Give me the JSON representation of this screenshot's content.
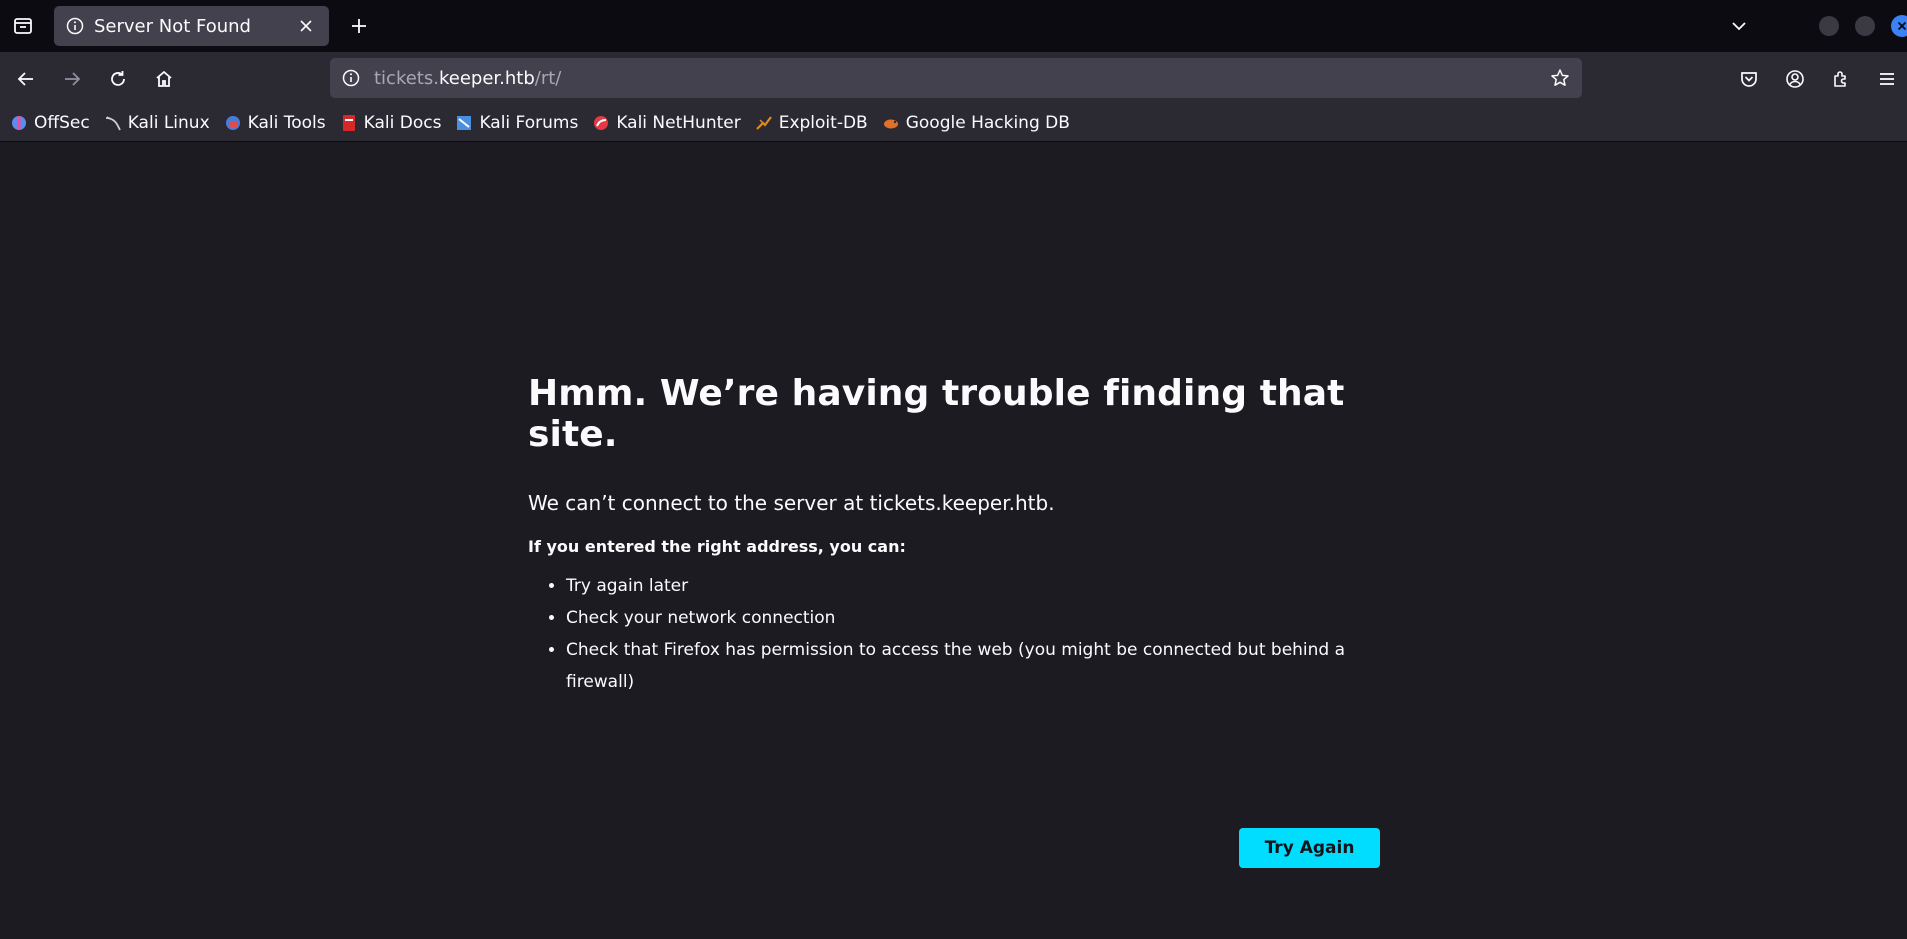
{
  "tab": {
    "title": "Server Not Found"
  },
  "urlbar": {
    "scheme_prefix": "tickets.",
    "host": "keeper.htb",
    "path": "/rt/"
  },
  "bookmarks": [
    {
      "label": "OffSec",
      "icon": "offsec-icon",
      "color": "#5b8def"
    },
    {
      "label": "Kali Linux",
      "icon": "kali-dragon-icon",
      "color": "#cfcfcf"
    },
    {
      "label": "Kali Tools",
      "icon": "kali-tools-icon",
      "color": "#e04b4b"
    },
    {
      "label": "Kali Docs",
      "icon": "kali-docs-icon",
      "color": "#d62828"
    },
    {
      "label": "Kali Forums",
      "icon": "kali-forums-icon",
      "color": "#4a90e2"
    },
    {
      "label": "Kali NetHunter",
      "icon": "kali-nethunter-icon",
      "color": "#e63946"
    },
    {
      "label": "Exploit-DB",
      "icon": "exploit-db-icon",
      "color": "#e08a1e"
    },
    {
      "label": "Google Hacking DB",
      "icon": "ghdb-icon",
      "color": "#e0702a"
    }
  ],
  "error": {
    "title": "Hmm. We’re having trouble finding that site.",
    "description": "We can’t connect to the server at tickets.keeper.htb.",
    "suggestions_heading": "If you entered the right address, you can:",
    "suggestions": [
      "Try again later",
      "Check your network connection",
      "Check that Firefox has permission to access the web (you might be connected but behind a firewall)"
    ],
    "try_again_label": "Try Again"
  },
  "colors": {
    "accent": "#00ddff",
    "background": "#1c1b22",
    "toolbar": "#2b2a33"
  }
}
